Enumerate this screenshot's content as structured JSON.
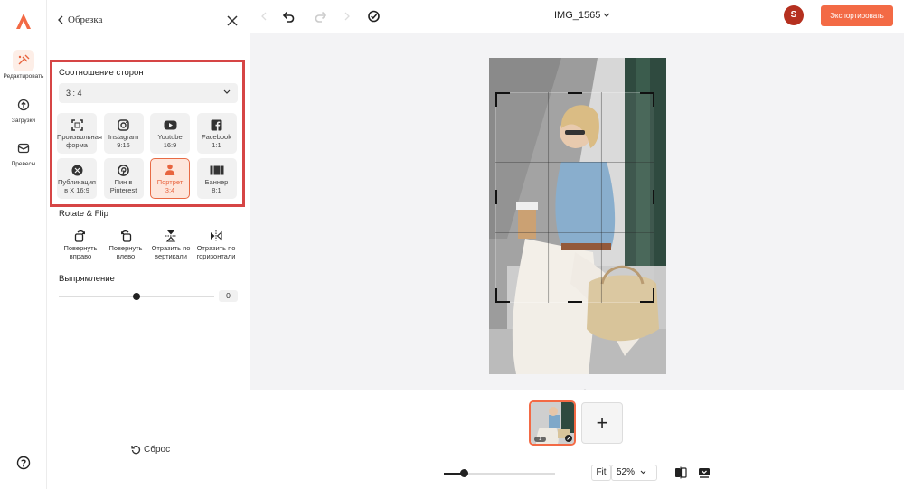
{
  "rail": {
    "items": [
      {
        "label": "Редактировать",
        "icon": "edit-icon",
        "active": true
      },
      {
        "label": "Загрузки",
        "icon": "upload-icon"
      },
      {
        "label": "Превесы",
        "icon": "presets-icon"
      }
    ]
  },
  "panel": {
    "title": "Обрезка",
    "aspect_label": "Соотношение сторон",
    "aspect_value": "3 : 4",
    "options": [
      {
        "label": "Произвольная форма",
        "sub": "",
        "icon": "freeform-icon"
      },
      {
        "label": "Instagram",
        "sub": "9:16",
        "icon": "instagram-icon"
      },
      {
        "label": "Youtube",
        "sub": "16:9",
        "icon": "youtube-icon"
      },
      {
        "label": "Facebook",
        "sub": "1:1",
        "icon": "facebook-icon"
      },
      {
        "label": "Публикация в X 16:9",
        "sub": "",
        "icon": "x-icon"
      },
      {
        "label": "Пин в Pinterest",
        "sub": "",
        "icon": "pinterest-icon"
      },
      {
        "label": "Портрет",
        "sub": "3:4",
        "icon": "portrait-icon",
        "selected": true
      },
      {
        "label": "Баннер",
        "sub": "8:1",
        "icon": "banner-icon"
      }
    ],
    "rotate_title": "Rotate & Flip",
    "rotate_actions": [
      {
        "label": "Повернуть вправо",
        "icon": "rotate-right-icon"
      },
      {
        "label": "Повернуть влево",
        "icon": "rotate-left-icon"
      },
      {
        "label": "Отразить по вертикали",
        "icon": "flip-vertical-icon"
      },
      {
        "label": "Отразить по горизонтали",
        "icon": "flip-horizontal-icon"
      }
    ],
    "straighten_label": "Выпрямление",
    "straighten_value": "0",
    "reset_label": "Сброс"
  },
  "topbar": {
    "file_name": "IMG_1565",
    "avatar_letter": "S",
    "export_label": "Экспортировать"
  },
  "bottom": {
    "thumb_index": "1",
    "add_label": "+",
    "fit_label": "Fit",
    "zoom_value": "52%",
    "zoom_level": 0.18
  },
  "colors": {
    "accent": "#f36a45",
    "highlight_border": "#d64545",
    "avatar": "#b5301f"
  }
}
